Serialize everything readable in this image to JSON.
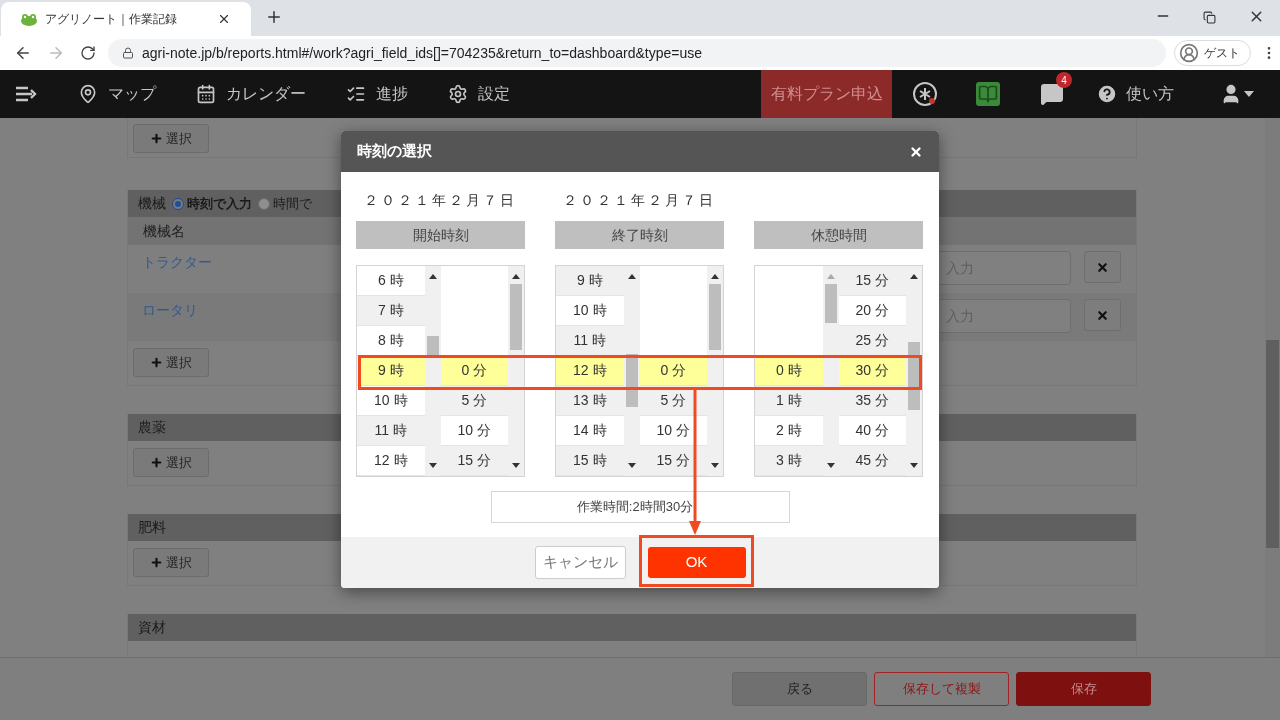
{
  "browser": {
    "tab_title": "アグリノート｜作業記録",
    "url": "agri-note.jp/b/reports.html#/work?agri_field_ids[]=704235&return_to=dashboard&type=use",
    "profile": "ゲスト"
  },
  "nav": {
    "items": [
      {
        "label": "マップ",
        "kind": "pin"
      },
      {
        "label": "カレンダー",
        "kind": "calendar"
      },
      {
        "label": "進捗",
        "kind": "progress"
      },
      {
        "label": "設定",
        "kind": "gear"
      }
    ],
    "plan_button": "有料プラン申込",
    "message_badge": "4",
    "help": "使い方"
  },
  "sections": [
    {
      "kind": "plain",
      "select": "選択"
    },
    {
      "kind": "machines",
      "title": "機械",
      "radios": [
        {
          "label": "時刻で入力",
          "selected": true
        },
        {
          "label": "時間で",
          "selected": false
        }
      ],
      "column": "機械名",
      "rows": [
        {
          "name": "トラクター",
          "placeholder": "入力"
        },
        {
          "name": "ロータリ",
          "placeholder": "入力"
        }
      ],
      "select": "選択"
    },
    {
      "kind": "plain",
      "title": "農薬",
      "select": "選択"
    },
    {
      "kind": "plain",
      "title": "肥料",
      "select": "選択"
    },
    {
      "kind": "plain",
      "title": "資材"
    }
  ],
  "footer": [
    {
      "label": "戻る",
      "kind": "default"
    },
    {
      "label": "保存して複製",
      "kind": "outline"
    },
    {
      "label": "保存",
      "kind": "primary"
    }
  ],
  "modal": {
    "title": "時刻の選択",
    "pickers": [
      {
        "date": "２０２１年２月７日",
        "header": "開始時刻",
        "hours": [
          {
            "text": "6 時",
            "selected": false,
            "shaded": false
          },
          {
            "text": "7 時",
            "selected": false,
            "shaded": true
          },
          {
            "text": "8 時",
            "selected": false,
            "shaded": false
          },
          {
            "text": "9 時",
            "selected": true
          },
          {
            "text": "10 時",
            "selected": false,
            "shaded": false
          },
          {
            "text": "11 時",
            "selected": false,
            "shaded": true
          },
          {
            "text": "12 時",
            "selected": false,
            "shaded": false
          }
        ],
        "minutes": [
          {
            "text": "0 分",
            "selected": true
          },
          {
            "text": "5 分",
            "selected": false,
            "shaded": true
          },
          {
            "text": "10 分",
            "selected": false,
            "shaded": false
          },
          {
            "text": "15 分",
            "selected": false,
            "shaded": true
          }
        ]
      },
      {
        "date": "２０２１年２月７日",
        "header": "終了時刻",
        "hours": [
          {
            "text": "9 時",
            "selected": false,
            "shaded": true
          },
          {
            "text": "10 時",
            "selected": false,
            "shaded": false
          },
          {
            "text": "11 時",
            "selected": false,
            "shaded": true
          },
          {
            "text": "12 時",
            "selected": true
          },
          {
            "text": "13 時",
            "selected": false,
            "shaded": true
          },
          {
            "text": "14 時",
            "selected": false,
            "shaded": false
          },
          {
            "text": "15 時",
            "selected": false,
            "shaded": true
          }
        ],
        "minutes": [
          {
            "text": "0 分",
            "selected": true
          },
          {
            "text": "5 分",
            "selected": false,
            "shaded": true
          },
          {
            "text": "10 分",
            "selected": false,
            "shaded": false
          },
          {
            "text": "15 分",
            "selected": false,
            "shaded": true
          }
        ]
      },
      {
        "header": "休憩時間",
        "hours": [
          {
            "text": "0 時",
            "selected": true
          },
          {
            "text": "1 時",
            "selected": false,
            "shaded": true
          },
          {
            "text": "2 時",
            "selected": false,
            "shaded": false
          },
          {
            "text": "3 時",
            "selected": false,
            "shaded": true
          }
        ],
        "minutes": [
          {
            "text": "15 分",
            "selected": false,
            "shaded": true
          },
          {
            "text": "20 分",
            "selected": false,
            "shaded": false
          },
          {
            "text": "25 分",
            "selected": false,
            "shaded": true
          },
          {
            "text": "30 分",
            "selected": true
          },
          {
            "text": "35 分",
            "selected": false,
            "shaded": true
          },
          {
            "text": "40 分",
            "selected": false,
            "shaded": false
          },
          {
            "text": "45 分",
            "selected": false,
            "shaded": true
          }
        ]
      }
    ],
    "total": "作業時間:2時間30分",
    "cancel": "キャンセル",
    "ok": "OK"
  }
}
